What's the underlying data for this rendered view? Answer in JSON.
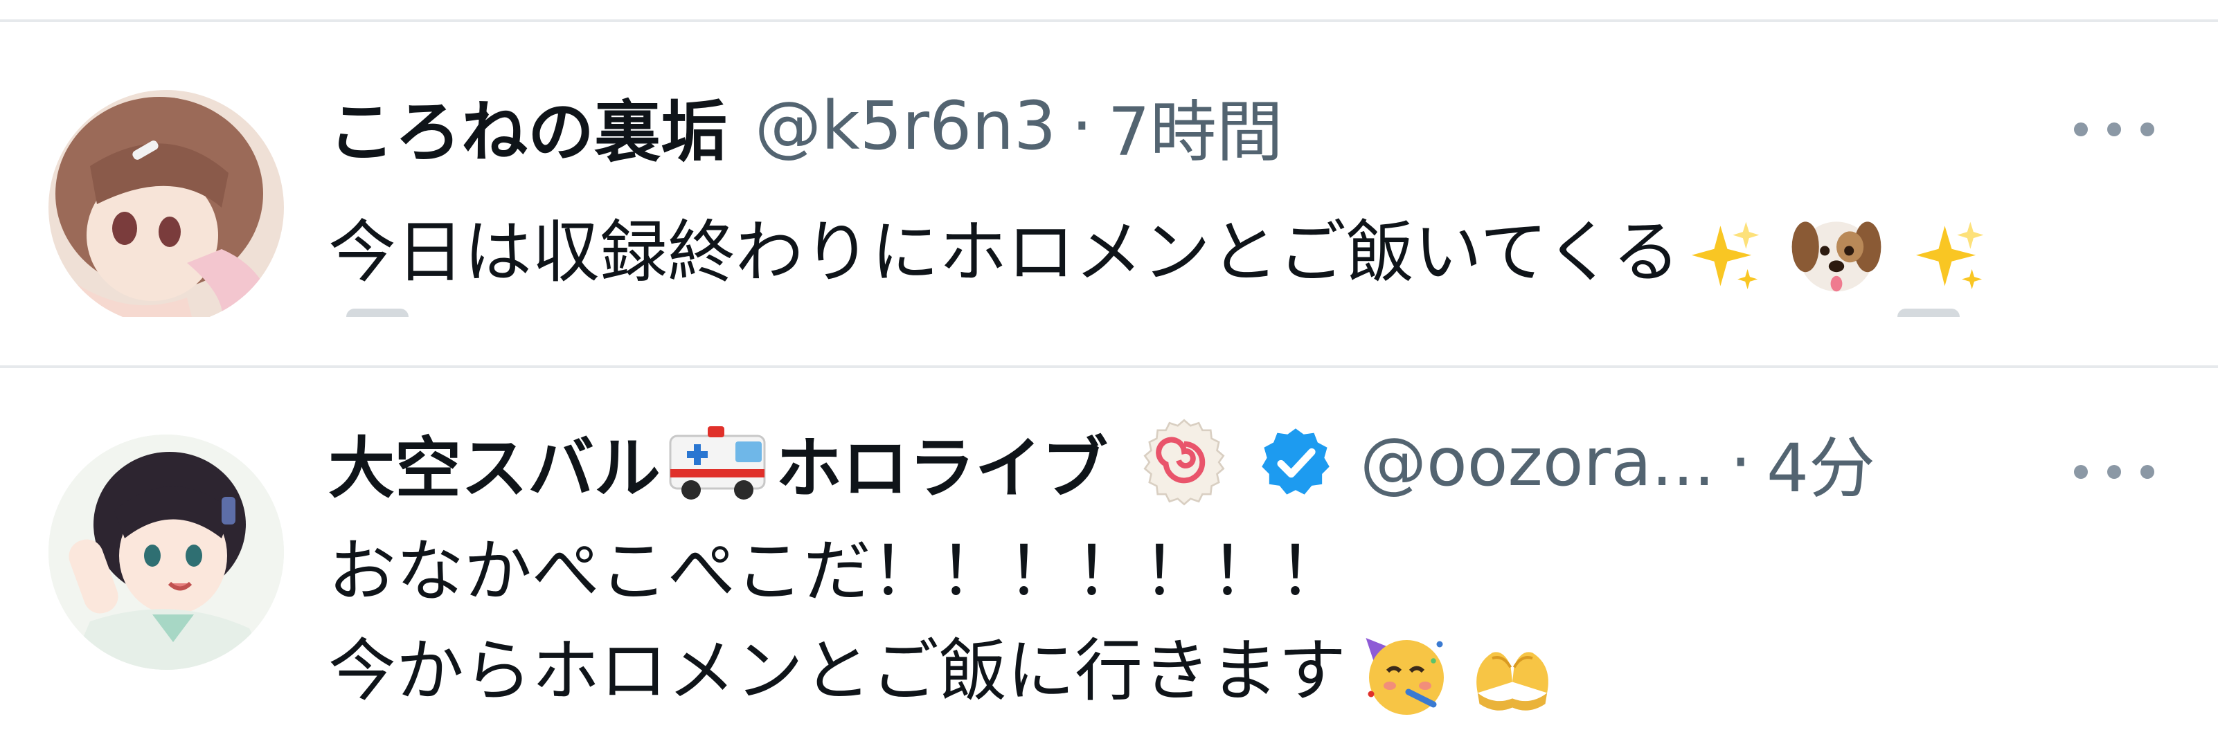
{
  "tweets": [
    {
      "display_name": "ころねの裏垢",
      "handle": "@k5r6n3",
      "separator": "·",
      "time": "7時間",
      "text_lines": [
        "今日は収録終わりにホロメンとご飯いてくる"
      ],
      "emojis": [
        "sparkles",
        "dog-face",
        "sparkles"
      ],
      "verified": false
    },
    {
      "display_name": "大空スバル",
      "display_name_suffix": "ホロライブ",
      "handle": "@oozora...",
      "separator": "·",
      "time": "4分",
      "text_lines": [
        "おなかぺこぺこだ！！！！！！！",
        "今からホロメンとご飯に行きます"
      ],
      "emojis": [
        "partying-face",
        "heart-hands"
      ],
      "name_emojis": [
        "ambulance",
        "fish-cake"
      ],
      "verified": true
    }
  ],
  "colors": {
    "text": "#0f1419",
    "secondary": "#536471",
    "verified": "#1d9bf0",
    "divider": "#e6e9ec"
  }
}
